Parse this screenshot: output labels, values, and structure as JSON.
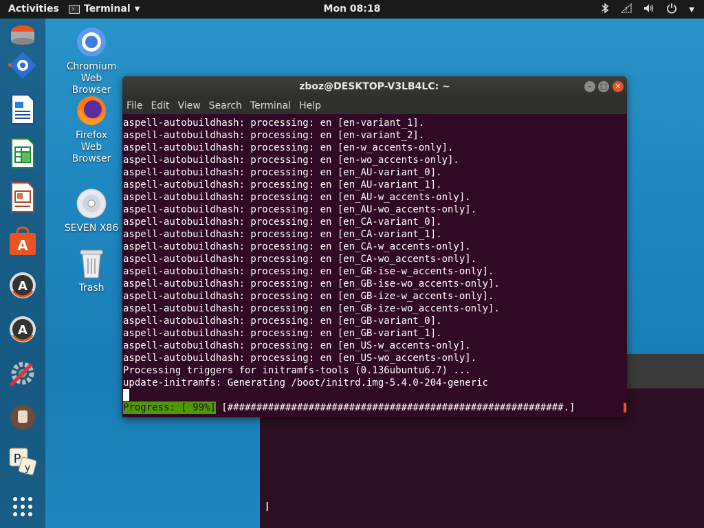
{
  "topbar": {
    "activities": "Activities",
    "app_name": "Terminal",
    "clock": "Mon 08:18"
  },
  "desktop_icons": [
    {
      "label": "Chromium\nWeb\nBrowser",
      "icon": "chromium-icon"
    },
    {
      "label": "Firefox\nWeb\nBrowser",
      "icon": "firefox-icon"
    },
    {
      "label": "SEVEN X86",
      "icon": "disc-icon"
    },
    {
      "label": "Trash",
      "icon": "trash-icon"
    }
  ],
  "terminal": {
    "title": "zboz@DESKTOP-V3LB4LC: ~",
    "menu": [
      "File",
      "Edit",
      "View",
      "Search",
      "Terminal",
      "Help"
    ],
    "lines": [
      "aspell-autobuildhash: processing: en [en-variant_1].",
      "aspell-autobuildhash: processing: en [en-variant_2].",
      "aspell-autobuildhash: processing: en [en-w_accents-only].",
      "aspell-autobuildhash: processing: en [en-wo_accents-only].",
      "aspell-autobuildhash: processing: en [en_AU-variant_0].",
      "aspell-autobuildhash: processing: en [en_AU-variant_1].",
      "aspell-autobuildhash: processing: en [en_AU-w_accents-only].",
      "aspell-autobuildhash: processing: en [en_AU-wo_accents-only].",
      "aspell-autobuildhash: processing: en [en_CA-variant_0].",
      "aspell-autobuildhash: processing: en [en_CA-variant_1].",
      "aspell-autobuildhash: processing: en [en_CA-w_accents-only].",
      "aspell-autobuildhash: processing: en [en_CA-wo_accents-only].",
      "aspell-autobuildhash: processing: en [en_GB-ise-w_accents-only].",
      "aspell-autobuildhash: processing: en [en_GB-ise-wo_accents-only].",
      "aspell-autobuildhash: processing: en [en_GB-ize-w_accents-only].",
      "aspell-autobuildhash: processing: en [en_GB-ize-wo_accents-only].",
      "aspell-autobuildhash: processing: en [en_GB-variant_0].",
      "aspell-autobuildhash: processing: en [en_GB-variant_1].",
      "aspell-autobuildhash: processing: en [en_US-w_accents-only].",
      "aspell-autobuildhash: processing: en [en_US-wo_accents-only].",
      "Processing triggers for initramfs-tools (0.136ubuntu6.7) ...",
      "update-initramfs: Generating /boot/initrd.img-5.4.0-204-generic"
    ],
    "progress_label": "Progress: [ 99%]",
    "progress_bar": " [##########################################################.] ",
    "progress_percent": 99
  },
  "colors": {
    "terminal_bg": "#300a24",
    "accent": "#e95420",
    "progress_label_bg": "#4e9a06"
  }
}
